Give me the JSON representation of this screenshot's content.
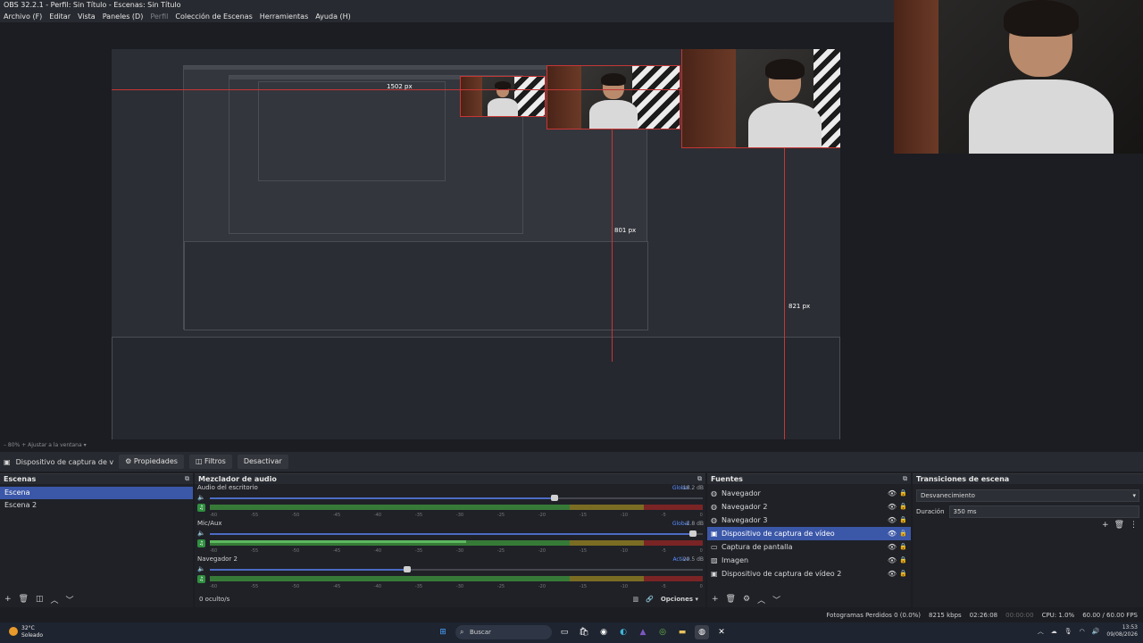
{
  "window": {
    "title": "OBS 32.2.1 - Perfil: Sin Título - Escenas: Sin Título"
  },
  "menu": {
    "items": [
      "Archivo (F)",
      "Editar",
      "Vista",
      "Paneles (D)",
      "Perfil",
      "Colección de Escenas",
      "Herramientas",
      "Ayuda (H)"
    ]
  },
  "preview": {
    "guide_label_1": "1502 px",
    "guide_label_2": "821 px",
    "guide_label_3": "801 px"
  },
  "zoom": {
    "value": "80%",
    "fit_label": "Ajustar a la ventana"
  },
  "source_toolbar": {
    "current_source": "Dispositivo de captura de v",
    "properties": "Propiedades",
    "filters": "Filtros",
    "deactivate": "Desactivar"
  },
  "scenes": {
    "title": "Escenas",
    "items": [
      "Escena",
      "Escena 2"
    ],
    "active_index": 0
  },
  "mixer": {
    "title": "Mezclador de audio",
    "tracks": [
      {
        "name": "Audio del escritorio",
        "badge": "Global",
        "db": "-18.2 dB",
        "volume": 0.7,
        "level": 0.0
      },
      {
        "name": "Mic/Aux",
        "badge": "Global",
        "db": "-1.8 dB",
        "volume": 0.98,
        "level": 0.52
      },
      {
        "name": "Navegador 2",
        "badge": "Active",
        "db": "-20.5 dB",
        "volume": 0.4,
        "level": 0.0
      }
    ],
    "ticks": [
      "-60",
      "-55",
      "-50",
      "-45",
      "-40",
      "-35",
      "-30",
      "-25",
      "-20",
      "-15",
      "-10",
      "-5",
      "0"
    ],
    "hidden_label": "0 oculto/s",
    "options_label": "Opciones"
  },
  "sources": {
    "title": "Fuentes",
    "items": [
      {
        "name": "Navegador",
        "icon": "globe-icon"
      },
      {
        "name": "Navegador 2",
        "icon": "globe-icon"
      },
      {
        "name": "Navegador 3",
        "icon": "globe-icon"
      },
      {
        "name": "Dispositivo de captura de vídeo",
        "icon": "camera-icon"
      },
      {
        "name": "Captura de pantalla",
        "icon": "monitor-icon"
      },
      {
        "name": "Imagen",
        "icon": "image-icon"
      },
      {
        "name": "Dispositivo de captura de vídeo 2",
        "icon": "camera-icon"
      }
    ],
    "active_index": 3
  },
  "transitions": {
    "title": "Transiciones de escena",
    "selected": "Desvanecimiento",
    "duration_label": "Duración",
    "duration_value": "350 ms"
  },
  "status": {
    "dropped": "Fotogramas Perdidos 0 (0.0%)",
    "bitrate": "8215 kbps",
    "time_live": "02:26:08",
    "time_rec": "00:00:00",
    "cpu": "CPU: 1.0%",
    "fps": "60.00 / 60.00 FPS"
  },
  "taskbar": {
    "weather_temp": "32°C",
    "weather_desc": "Soleado",
    "search_placeholder": "Buscar",
    "time": "13:53",
    "date": "09/08/2026"
  },
  "colors": {
    "accent": "#3b57a8",
    "guide": "#c73636",
    "meter_green": "#3b8a3b",
    "meter_yellow": "#8a7a22",
    "meter_red": "#8a2525"
  }
}
